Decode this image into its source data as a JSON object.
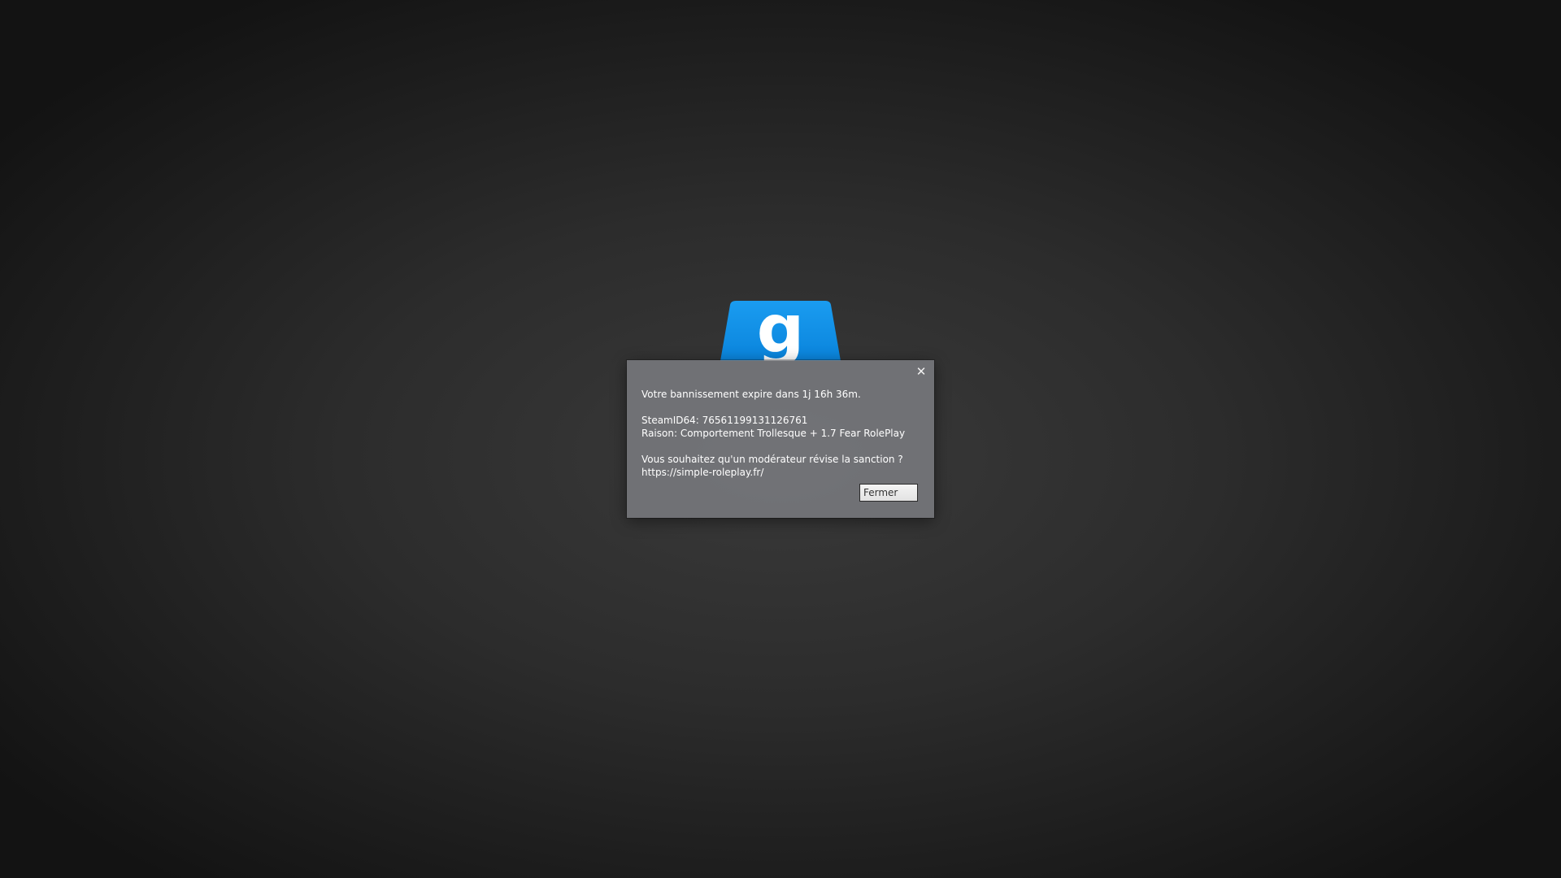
{
  "logo": {
    "letter": "g",
    "color": "#1193eb"
  },
  "dialog": {
    "close_icon": "close-icon",
    "close_glyph": "✕",
    "lines": {
      "expiry": "Votre bannissement expire dans 1j 16h 36m.",
      "steamid": "SteamID64: 76561199131126761",
      "reason": "Raison: Comportement Trollesque + 1.7 Fear RolePlay",
      "question": "Vous souhaitez qu'un modérateur révise la sanction ?",
      "url": "https://simple-roleplay.fr/"
    },
    "button_label": "Fermer"
  }
}
